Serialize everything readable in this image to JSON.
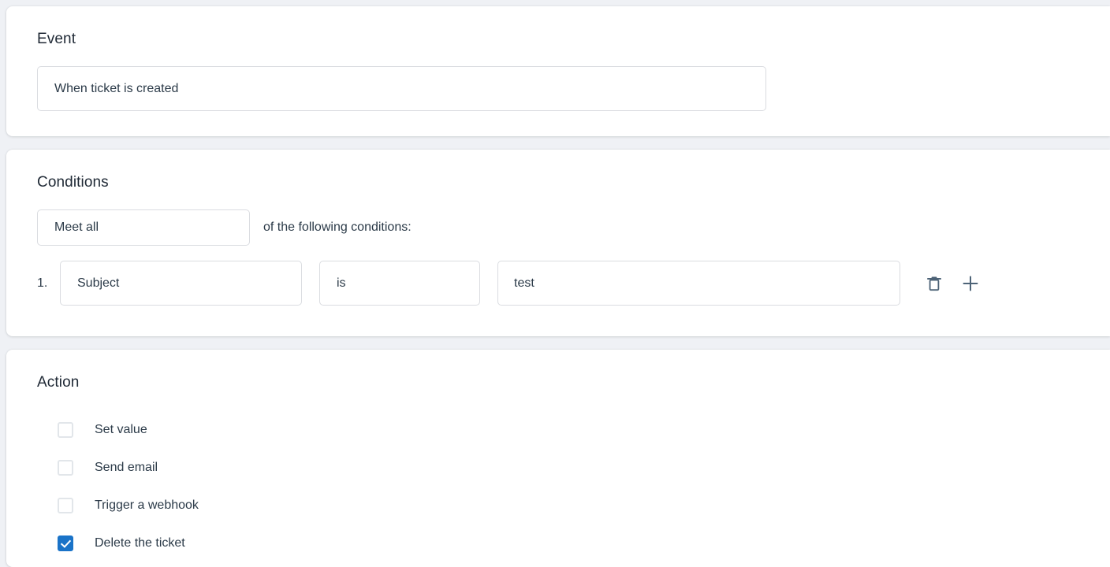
{
  "theme": {
    "page_background": "#eff1f5",
    "card_background": "#ffffff",
    "heading_color": "#202a36",
    "text_color": "#2b3a48",
    "border_color": "#dadce0",
    "accent_checked": "#1a73c8",
    "icon_color": "#4d6377"
  },
  "event_section": {
    "title": "Event",
    "event_select": {
      "name": "event-select",
      "value": "When ticket is created",
      "caret_icon": "chevron-down-icon"
    }
  },
  "conditions_section": {
    "title": "Conditions",
    "match_select": {
      "name": "match-type-select",
      "value": "Meet all",
      "caret_icon": "chevron-down-icon"
    },
    "suffix_text": "of the following conditions:",
    "rows": [
      {
        "index": "1.",
        "field": "Subject",
        "operator": "is",
        "value": "test",
        "value_placeholder": "",
        "delete_icon": "trash-icon",
        "add_icon": "plus-icon"
      }
    ]
  },
  "action_section": {
    "title": "Action",
    "options": [
      {
        "label": "Set value",
        "checked": false
      },
      {
        "label": "Send email",
        "checked": false
      },
      {
        "label": "Trigger a webhook",
        "checked": false
      },
      {
        "label": "Delete the ticket",
        "checked": true
      }
    ]
  }
}
